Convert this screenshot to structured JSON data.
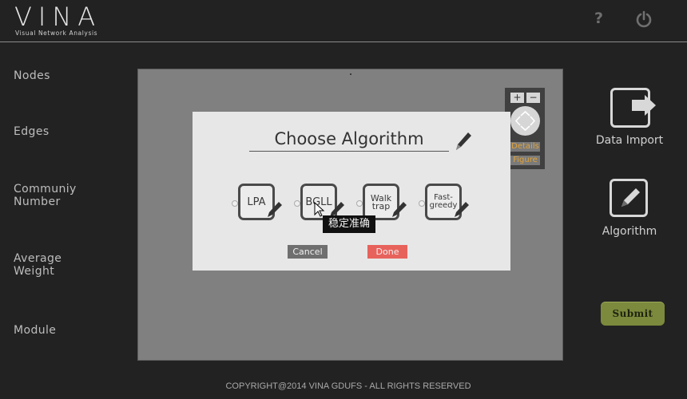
{
  "header": {
    "logo_title": "VINA",
    "logo_subtitle": "Visual Network Analysis",
    "help_icon": "question-icon",
    "power_icon": "power-icon"
  },
  "stats": {
    "nodes": "Nodes",
    "edges": "Edges",
    "community_number_line1": "Communiy",
    "community_number_line2": "Number",
    "average_weight_line1": "Average",
    "average_weight_line2": "Weight",
    "module": "Module"
  },
  "nav_control": {
    "zoom_in": "+",
    "zoom_out": "−",
    "details": "Details",
    "figure": "Figure"
  },
  "side": {
    "data_import": "Data Import",
    "algorithm": "Algorithm",
    "submit": "Submit"
  },
  "dialog": {
    "title": "Choose Algorithm",
    "algorithms": [
      {
        "label": "LPA"
      },
      {
        "label": "BGLL"
      },
      {
        "label_line1": "Walk",
        "label_line2": "trap"
      },
      {
        "label_line1": "Fast-",
        "label_line2": "greedy"
      }
    ],
    "tooltip": "稳定准确",
    "cancel": "Cancel",
    "done": "Done"
  },
  "colors": {
    "background": "#222222",
    "canvas": "#808080",
    "dialog": "#e7e7e7",
    "done_button": "#e8625c",
    "cancel_button": "#6f6f6f",
    "submit_button": "#7b8a3c",
    "link_orange": "#e0a33a"
  },
  "footer": {
    "copyright": "COPYRIGHT@2014 VINA GDUFS  -  ALL RIGHTS RESERVED"
  }
}
